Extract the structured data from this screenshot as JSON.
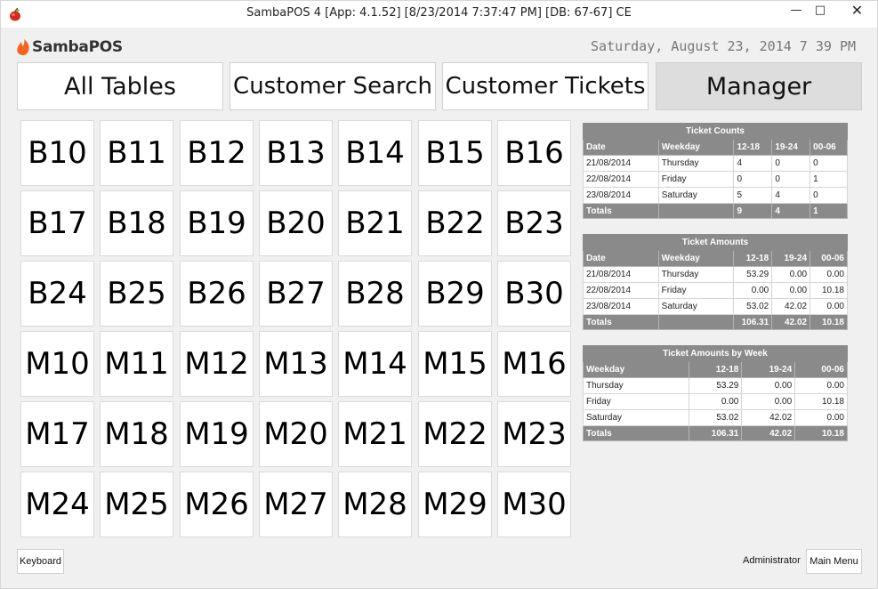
{
  "window": {
    "title": "SambaPOS 4 [App: 4.1.52] [8/23/2014 7:37:47 PM] [DB: 67-67] CE",
    "minimize": "—",
    "maximize": "□",
    "close": "✕"
  },
  "header": {
    "logo_text": "SambaPOS",
    "datetime": "Saturday, August 23, 2014 7 39 PM"
  },
  "nav": {
    "all_tables": "All Tables",
    "customer_search": "Customer Search",
    "customer_tickets": "Customer Tickets",
    "manager": "Manager"
  },
  "tables": [
    "B10",
    "B11",
    "B12",
    "B13",
    "B14",
    "B15",
    "B16",
    "B17",
    "B18",
    "B19",
    "B20",
    "B21",
    "B22",
    "B23",
    "B24",
    "B25",
    "B26",
    "B27",
    "B28",
    "B29",
    "B30",
    "M10",
    "M11",
    "M12",
    "M13",
    "M14",
    "M15",
    "M16",
    "M17",
    "M18",
    "M19",
    "M20",
    "M21",
    "M22",
    "M23",
    "M24",
    "M25",
    "M26",
    "M27",
    "M28",
    "M29",
    "M30"
  ],
  "reports": {
    "counts": {
      "title": "Ticket Counts",
      "headers": [
        "Date",
        "Weekday",
        "12-18",
        "19-24",
        "00-06"
      ],
      "rows": [
        [
          "21/08/2014",
          "Thursday",
          "4",
          "0",
          "0"
        ],
        [
          "22/08/2014",
          "Friday",
          "0",
          "0",
          "1"
        ],
        [
          "23/08/2014",
          "Saturday",
          "5",
          "4",
          "0"
        ]
      ],
      "totals": [
        "Totals",
        "",
        "9",
        "4",
        "1"
      ]
    },
    "amounts": {
      "title": "Ticket Amounts",
      "headers": [
        "Date",
        "Weekday",
        "12-18",
        "19-24",
        "00-06"
      ],
      "rows": [
        [
          "21/08/2014",
          "Thursday",
          "53.29",
          "0.00",
          "0.00"
        ],
        [
          "22/08/2014",
          "Friday",
          "0.00",
          "0.00",
          "10.18"
        ],
        [
          "23/08/2014",
          "Saturday",
          "53.02",
          "42.02",
          "0.00"
        ]
      ],
      "totals": [
        "Totals",
        "",
        "106.31",
        "42.02",
        "10.18"
      ]
    },
    "week": {
      "title": "Ticket Amounts by Week",
      "headers": [
        "Weekday",
        "12-18",
        "19-24",
        "00-06"
      ],
      "rows": [
        [
          "Thursday",
          "53.29",
          "0.00",
          "0.00"
        ],
        [
          "Friday",
          "0.00",
          "0.00",
          "10.18"
        ],
        [
          "Saturday",
          "53.02",
          "42.02",
          "0.00"
        ]
      ],
      "totals": [
        "Totals",
        "106.31",
        "42.02",
        "10.18"
      ]
    }
  },
  "footer": {
    "keyboard": "Keyboard",
    "user": "Administrator",
    "main_menu": "Main Menu"
  },
  "colors": {
    "background": "#f0f0f0",
    "button": "#ffffff",
    "active_tab": "#dddddd",
    "table_header": "#8a8a8a",
    "logo_accent": "#f26522"
  }
}
